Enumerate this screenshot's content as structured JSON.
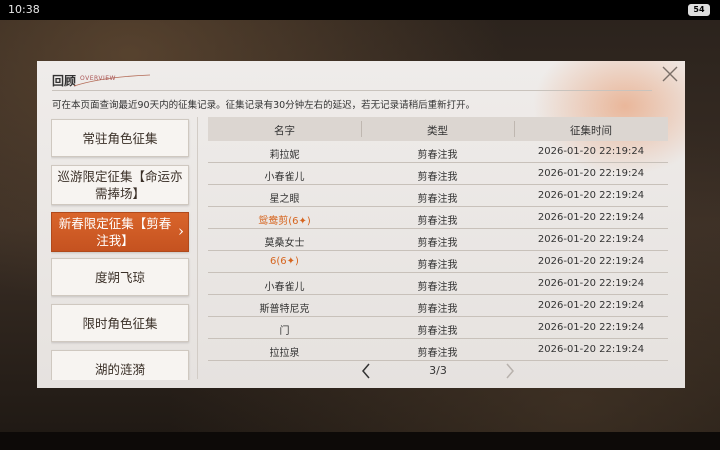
{
  "statusbar": {
    "time": "10:38",
    "battery": "54"
  },
  "dialog": {
    "title": "回顾",
    "title_sub": "OVERVIEW",
    "notice": "可在本页面查询最近90天内的征集记录。征集记录有30分钟左右的延迟，若无记录请稍后重新打开。"
  },
  "categories": [
    {
      "label": "常驻角色征集"
    },
    {
      "label": "巡游限定征集【命运亦需捧场】"
    },
    {
      "label": "新春限定征集【剪春注我】",
      "active": true
    },
    {
      "label": "度朔飞琼"
    },
    {
      "label": "限时角色征集"
    },
    {
      "label": "湖的涟漪"
    }
  ],
  "table": {
    "headers": [
      "名字",
      "类型",
      "征集时间"
    ],
    "rows": [
      {
        "name": "莉拉妮",
        "type": "剪春注我",
        "time": "2026-01-20 22:19:24"
      },
      {
        "name": "小春雀儿",
        "type": "剪春注我",
        "time": "2026-01-20 22:19:24"
      },
      {
        "name": "星之眼",
        "type": "剪春注我",
        "time": "2026-01-20 22:19:24"
      },
      {
        "name": "鸳鸯剪(6✦)",
        "type": "剪春注我",
        "time": "2026-01-20 22:19:24",
        "highlight": true
      },
      {
        "name": "莫桑女士",
        "type": "剪春注我",
        "time": "2026-01-20 22:19:24"
      },
      {
        "name": "6(6✦)",
        "type": "剪春注我",
        "time": "2026-01-20 22:19:24",
        "highlight": true
      },
      {
        "name": "小春雀儿",
        "type": "剪春注我",
        "time": "2026-01-20 22:19:24"
      },
      {
        "name": "斯普特尼克",
        "type": "剪春注我",
        "time": "2026-01-20 22:19:24"
      },
      {
        "name": "门",
        "type": "剪春注我",
        "time": "2026-01-20 22:19:24"
      },
      {
        "name": "拉拉泉",
        "type": "剪春注我",
        "time": "2026-01-20 22:19:24"
      }
    ]
  },
  "pager": {
    "text": "3/3"
  },
  "colors": {
    "accent": "#d6651f",
    "active_bg": "#c55220",
    "panel": "#ebe7e4"
  },
  "icons": {
    "close": "close-icon",
    "prev": "chevron-left-icon",
    "next": "chevron-right-icon",
    "active_chevron": "chevron-right-icon"
  }
}
